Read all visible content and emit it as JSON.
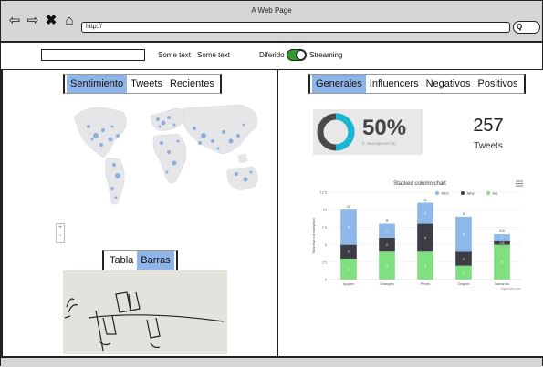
{
  "window": {
    "title": "A Web Page",
    "url": "http://"
  },
  "nav": {
    "icons": [
      "back-arrow-icon",
      "forward-arrow-icon",
      "close-icon",
      "home-icon"
    ]
  },
  "toolbar": {
    "input_value": "",
    "text1": "Some text",
    "text2": "Some text",
    "toggle_left": "Diferido",
    "toggle_right": "Streaming",
    "toggle_on": true
  },
  "left_panel": {
    "tabs": [
      {
        "label": "Sentimiento",
        "active": true
      },
      {
        "label": "Tweets",
        "active": false
      },
      {
        "label": "Recientes",
        "active": false
      }
    ],
    "zoom": {
      "plus": "+",
      "minus": "-"
    },
    "tabs2": [
      {
        "label": "Tabla",
        "active": false
      },
      {
        "label": "Barras",
        "active": true
      }
    ]
  },
  "right_panel": {
    "tabs": [
      {
        "label": "Generales",
        "active": true
      },
      {
        "label": "Influencers",
        "active": false
      },
      {
        "label": "Negativos",
        "active": false
      },
      {
        "label": "Positivos",
        "active": false
      }
    ],
    "kpi_percent": "50%",
    "kpi_percent_sub": "5. Suscriptores (5)",
    "kpi_number": "257",
    "kpi_label": "Tweets"
  },
  "colors": {
    "accent": "#8fb5e8",
    "toggle": "#2e9b2e",
    "donut": "#17b5d6"
  },
  "chart_data": {
    "type": "bar",
    "stacked": true,
    "title": "Stacked column chart",
    "categories": [
      "Apples",
      "Oranges",
      "Pears",
      "Grapes",
      "Bananas"
    ],
    "series": [
      {
        "name": "John",
        "color": "#8fb8ea",
        "values": [
          5,
          2,
          3,
          5,
          1
        ]
      },
      {
        "name": "Jane",
        "color": "#3c3c44",
        "values": [
          2,
          2,
          4,
          2,
          0.5
        ]
      },
      {
        "name": "Joe",
        "color": "#7fe07f",
        "values": [
          3,
          4,
          4,
          2,
          5
        ]
      }
    ],
    "totals": [
      10,
      8,
      11,
      9,
      6.5
    ],
    "ylabel": "Total fruit consumption",
    "yticks": [
      0,
      2.5,
      5,
      7.5,
      10,
      12.5
    ],
    "ylim": [
      0,
      12.5
    ],
    "legend": "top-right",
    "credit": "Highcharts.com"
  }
}
